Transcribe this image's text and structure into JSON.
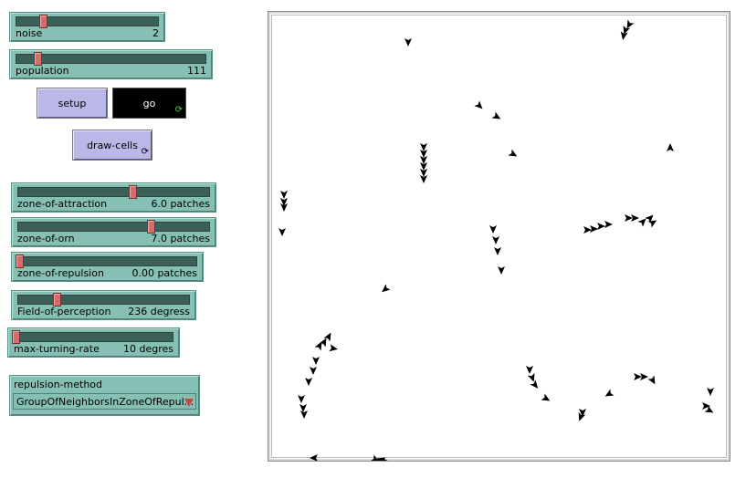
{
  "sliders": {
    "noise": {
      "label": "noise",
      "value": "2",
      "fraction": 0.18
    },
    "population": {
      "label": "population",
      "value": "111",
      "fraction": 0.11
    },
    "zone_of_attraction": {
      "label": "zone-of-attraction",
      "value": "6.0 patches",
      "fraction": 0.6
    },
    "zone_of_orn": {
      "label": "zone-of-orn",
      "value": "7.0 patches",
      "fraction": 0.7
    },
    "zone_of_repulsion": {
      "label": "zone-of-repulsion",
      "value": "0.00 patches",
      "fraction": 0.0
    },
    "field_of_perception": {
      "label": "Field-of-perception",
      "value": "236 degress",
      "fraction": 0.22
    },
    "max_turning_rate": {
      "label": "max-turning-rate",
      "value": "10 degres",
      "fraction": 0.0
    }
  },
  "buttons": {
    "setup": "setup",
    "go": "go",
    "draw_cells": "draw-cells"
  },
  "chooser": {
    "title": "repulsion-method",
    "selected": "GroupOfNeighborsInZoneOfRepul..."
  },
  "colors": {
    "slider": "#86bfb3",
    "button": "#b9b8e6",
    "thumb": "#d66b6b"
  },
  "icons": {
    "forever": "forever-icon",
    "turtle": "arrowhead-turtle-icon"
  }
}
